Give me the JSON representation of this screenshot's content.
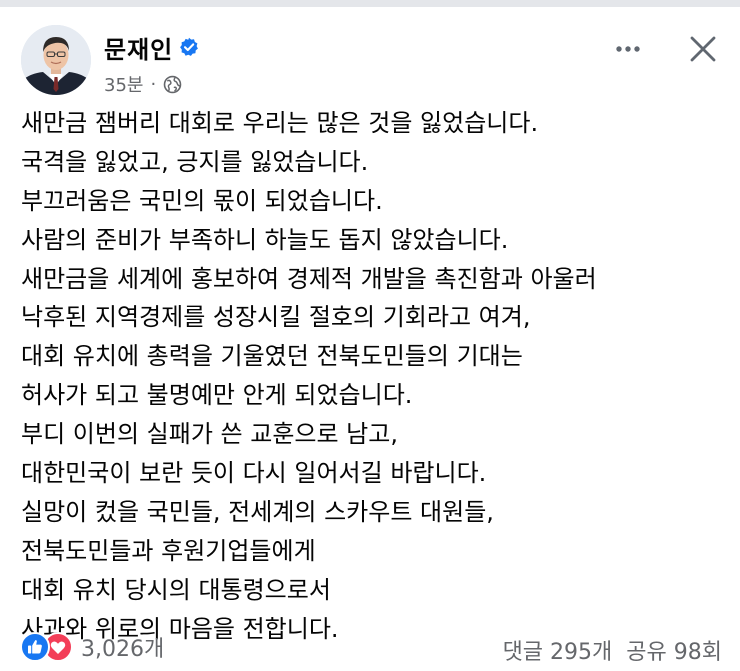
{
  "post": {
    "author": "문재인",
    "time": "35분",
    "separator": "·",
    "lines": [
      "새만금 잼버리 대회로 우리는 많은 것을 잃었습니다.",
      "국격을 잃었고, 긍지를 잃었습니다.",
      "부끄러움은 국민의 몫이 되었습니다.",
      "사람의 준비가 부족하니 하늘도 돕지 않았습니다.",
      "새만금을 세계에 홍보하여 경제적 개발을 촉진함과 아울러",
      "낙후된 지역경제를 성장시킬 절호의 기회라고 여겨,",
      "대회 유치에 총력을 기울였던 전북도민들의 기대는",
      "허사가 되고 불명예만 안게 되었습니다.",
      "부디 이번의 실패가 쓴 교훈으로 남고,",
      "대한민국이 보란 듯이 다시 일어서길 바랍니다.",
      "실망이 컸을 국민들, 전세계의 스카우트 대원들,",
      "전북도민들과 후원기업들에게",
      "대회 유치 당시의 대통령으로서",
      "사과와 위로의 마음을 전합니다."
    ]
  },
  "footer": {
    "reactions_count": "3,026개",
    "comments": "댓글 295개",
    "shares": "공유 98회"
  },
  "icons": {
    "verified": "verified-badge-icon",
    "audience": "globe-icon",
    "more": "more-horizontal-icon",
    "close": "close-icon",
    "like": "like-icon",
    "love": "love-icon"
  },
  "colors": {
    "verified_blue": "#1877f2",
    "like_blue": "#1877f2",
    "love_red": "#f33e58",
    "secondary_text": "#65676b",
    "primary_text": "#050505"
  }
}
